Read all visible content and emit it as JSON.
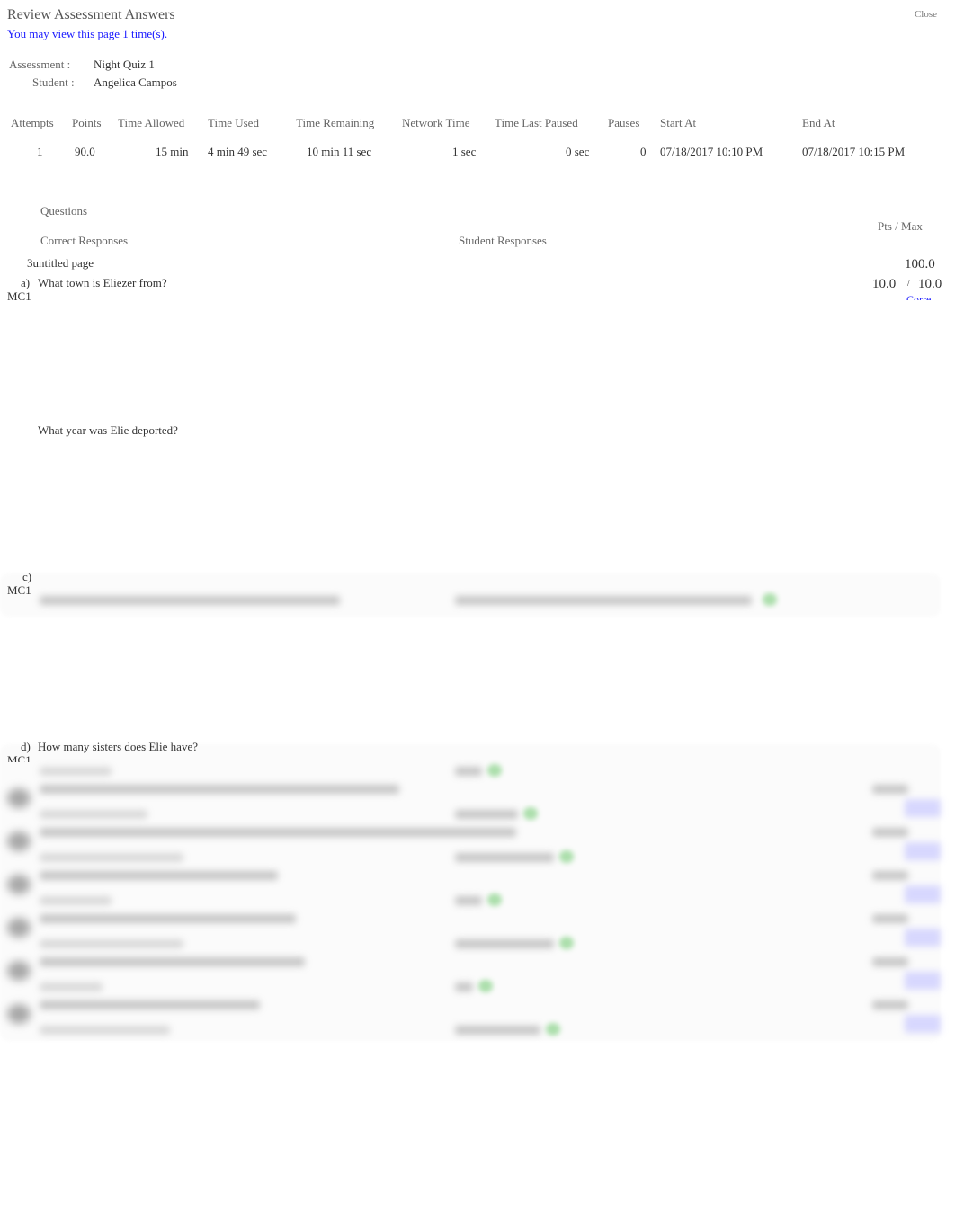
{
  "header": {
    "title": "Review Assessment Answers",
    "view_notice": "You may view this page 1 time(s).",
    "close_label": "Close"
  },
  "info": {
    "assessment_label": "Assessment :",
    "assessment_value": "Night Quiz 1",
    "student_label": "Student :",
    "student_value": "Angelica Campos"
  },
  "summary": {
    "headers": [
      "Attempts",
      "Points",
      "Time Allowed",
      "Time Used",
      "Time Remaining",
      "Network Time",
      "Time Last Paused",
      "Pauses",
      "Start At",
      "End At"
    ],
    "values": [
      "1",
      "90.0",
      "15 min",
      "4 min 49 sec",
      "10 min 11 sec",
      "1 sec",
      "0 sec",
      "0",
      "07/18/2017 10:10 PM",
      "07/18/2017 10:15 PM"
    ]
  },
  "questions_table": {
    "questions_label": "Questions",
    "correct_label": "Correct Responses",
    "student_label": "Student Responses",
    "pts_label": "Pts / Max",
    "page_name": "3untitled page",
    "page_total": "100.0",
    "items": [
      {
        "letter": "a)",
        "text": "What town is Eliezer from?",
        "type": "MC1",
        "pts": "10.0",
        "sep": "/",
        "max": "10.0",
        "link": "Corre"
      },
      {
        "letter": "",
        "text": "What year was Elie deported?",
        "type": "",
        "pts": "",
        "max": ""
      },
      {
        "letter": "c)",
        "text": "",
        "type": "MC1"
      },
      {
        "letter": "d)",
        "text": "How many sisters does Elie have?",
        "type": "MC1"
      }
    ]
  }
}
